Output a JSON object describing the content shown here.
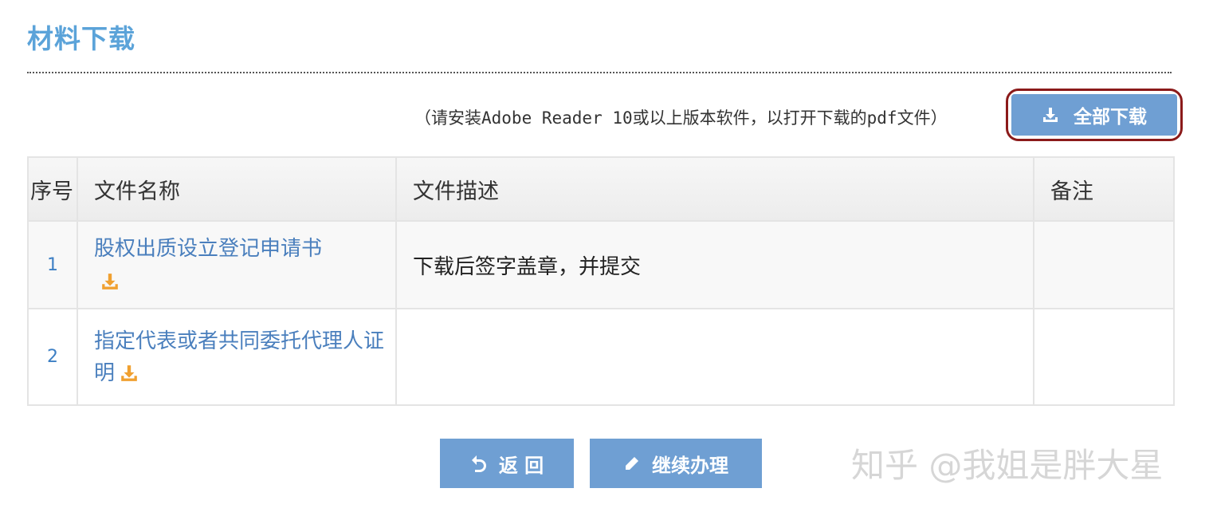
{
  "section_title": "材料下载",
  "hint_text": "（请安装Adobe Reader 10或以上版本软件，以打开下载的pdf文件）",
  "download_all_label": "全部下载",
  "table": {
    "headers": {
      "no": "序号",
      "name": "文件名称",
      "desc": "文件描述",
      "remark": "备注"
    },
    "rows": [
      {
        "no": "1",
        "name": "股权出质设立登记申请书",
        "desc": "下载后签字盖章，并提交",
        "remark": ""
      },
      {
        "no": "2",
        "name": "指定代表或者共同委托代理人证明",
        "desc": "",
        "remark": ""
      }
    ]
  },
  "buttons": {
    "back": "返 回",
    "continue": "继续办理"
  },
  "watermark": "知乎 @我姐是胖大星",
  "colors": {
    "accent": "#5ba3d9",
    "button": "#6f9fd3",
    "link": "#4a7fbd",
    "download_icon": "#f0a030",
    "highlight_border": "#8b1a1a"
  },
  "icons": {
    "download_all": "download-icon",
    "file_download": "download-icon",
    "back": "return-arrow-icon",
    "continue": "pencil-icon"
  }
}
